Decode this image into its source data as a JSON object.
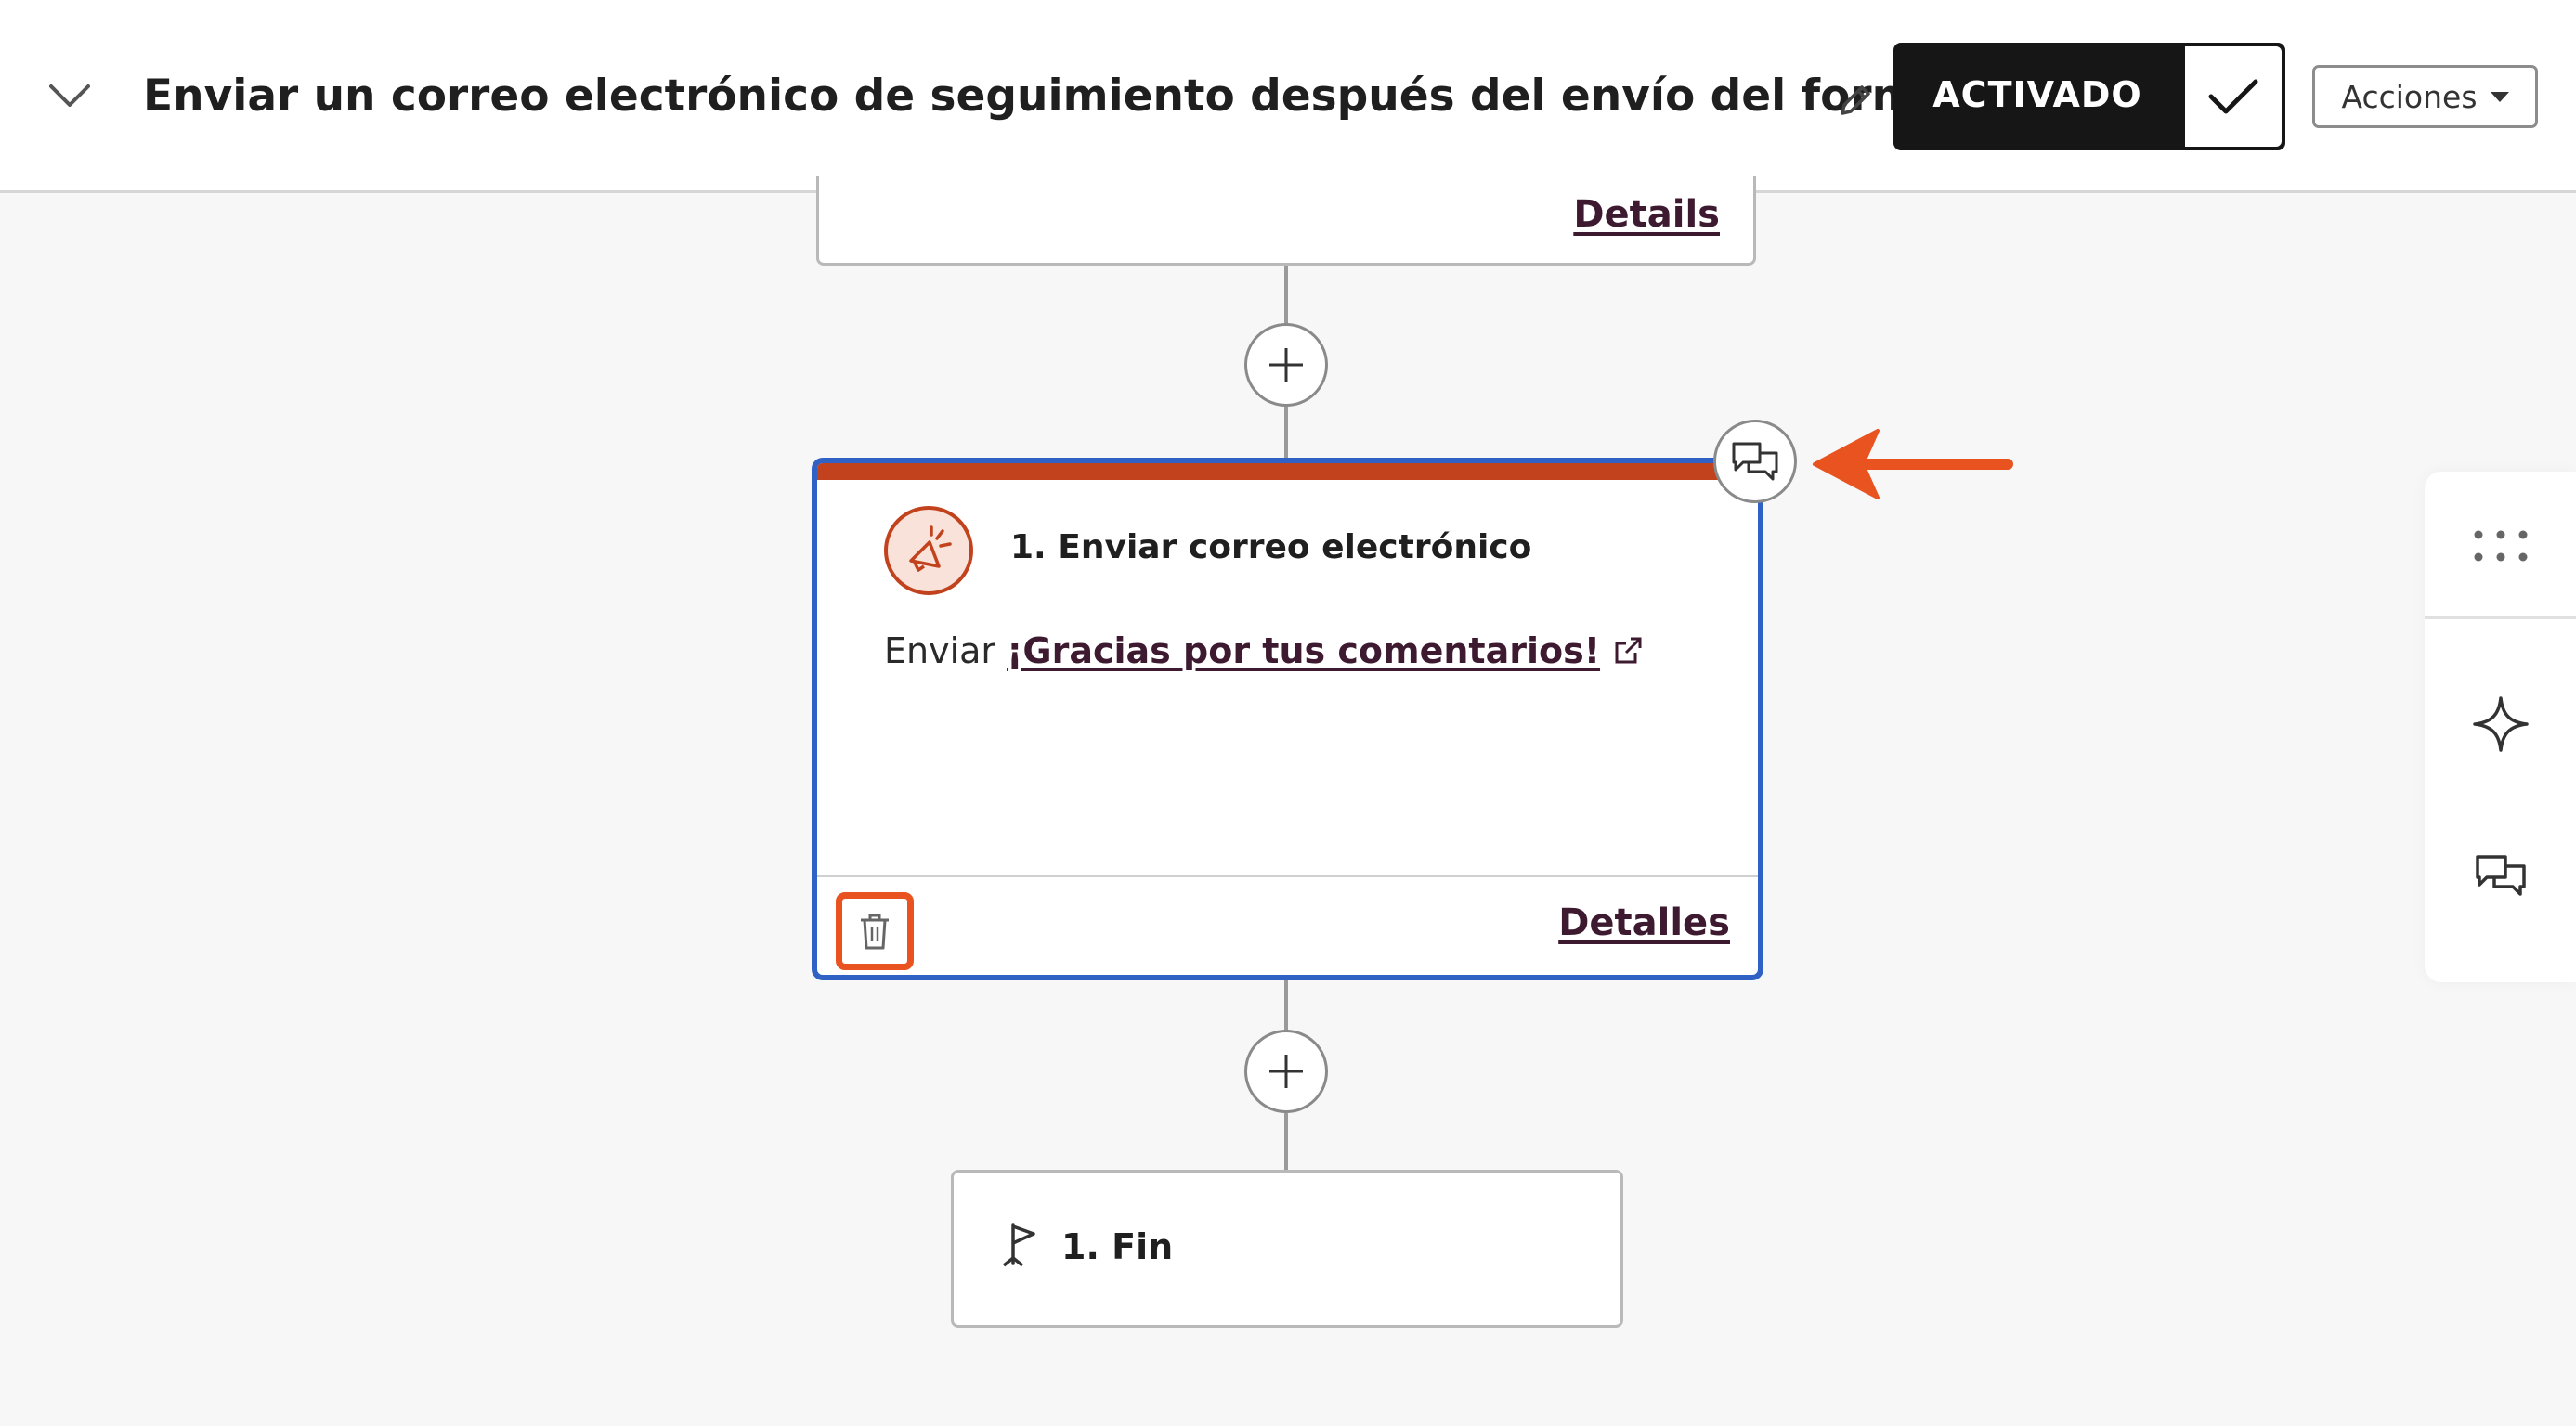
{
  "header": {
    "title": "Enviar un correo electrónico de seguimiento después del envío del formulario",
    "toggle_label": "ACTIVADO",
    "actions_label": "Acciones"
  },
  "previous_card": {
    "details_label": "Details"
  },
  "action_card": {
    "title": "1. Enviar correo electrónico",
    "body_prefix": "Enviar",
    "email_link": "¡Gracias por tus comentarios!",
    "details_label": "Detalles",
    "accent_color": "#c2421d",
    "selected_border_color": "#2f62c4"
  },
  "end_card": {
    "label": "1. Fin"
  },
  "annotations": {
    "highlight_color": "#e8531f"
  },
  "icons": {
    "collapse": "chevron-down-icon",
    "edit": "pencil-icon",
    "toggle_state": "checkmark-icon",
    "add_step": "plus-icon",
    "comments": "comments-icon",
    "action": "megaphone-icon",
    "external": "external-link-icon",
    "delete": "trash-icon",
    "end": "flag-icon",
    "rail_grid": "grip-dots-icon",
    "rail_ai": "sparkle-icon",
    "rail_comments": "comments-icon"
  }
}
